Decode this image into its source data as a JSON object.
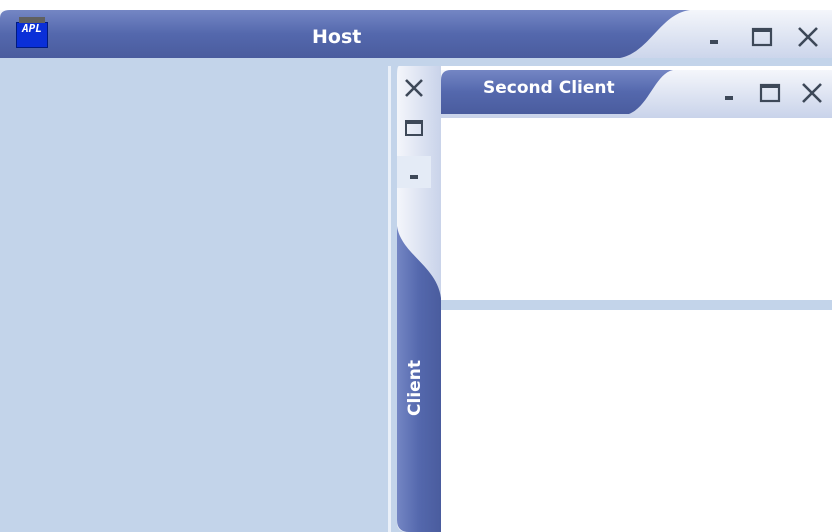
{
  "host": {
    "title": "Host",
    "app_icon": {
      "name": "app-icon",
      "text": "APL"
    },
    "buttons": {
      "minimize": "minimize-icon",
      "maximize": "maximize-icon",
      "close": "close-icon"
    }
  },
  "client_tab": {
    "label": "Client",
    "buttons": [
      "close-icon",
      "maximize-icon",
      "minimize-icon"
    ]
  },
  "second_client": {
    "title": "Second Client",
    "buttons": {
      "minimize": "minimize-icon",
      "maximize": "maximize-icon",
      "close": "close-icon"
    }
  },
  "colors": {
    "titlebar_dark": "#5a6fae",
    "titlebar_light": "#dfe6f5",
    "pane_background": "#c3d4ea",
    "content_background": "#ffffff",
    "icon": "#3d4858"
  }
}
